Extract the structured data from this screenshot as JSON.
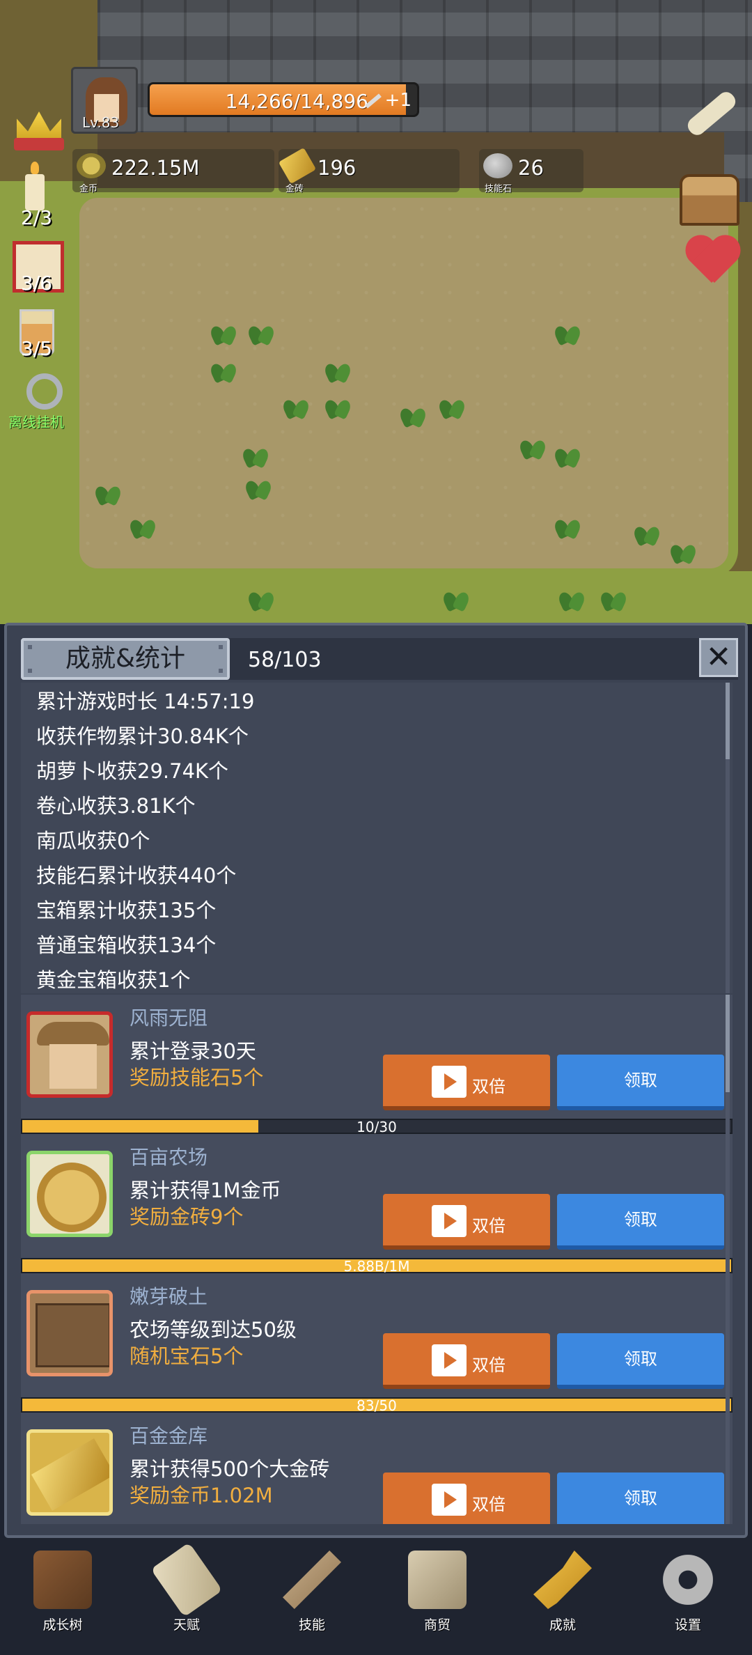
{
  "hud": {
    "level": "Lv.83",
    "hp_text": "14,266/14,896",
    "hp_fraction": 0.958,
    "hp_bonus": "+1",
    "resources": [
      {
        "caption": "金币",
        "value": "222.15M",
        "icon": "coin-icon"
      },
      {
        "caption": "金砖",
        "value": "196",
        "icon": "gold-brick-icon"
      },
      {
        "caption": "技能石",
        "value": "26",
        "icon": "skill-stone-icon"
      }
    ],
    "side": {
      "candle_count": "2/3",
      "dice_count": "3/6",
      "drink_count": "3/5",
      "offline_label": "离线挂机"
    }
  },
  "panel": {
    "title": "成就&统计",
    "count": "58/103",
    "close_icon": "close-icon",
    "stats": [
      "累计游戏时长 14:57:19",
      "收获作物累计30.84K个",
      "胡萝卜收获29.74K个",
      "卷心收获3.81K个",
      "南瓜收获0个",
      "技能石累计收获440个",
      "宝箱累计收获135个",
      "普通宝箱收获134个",
      "黄金宝箱收获1个"
    ],
    "achievements": [
      {
        "name": "风雨无阻",
        "desc": "累计登录30天",
        "reward": "奖励技能石5个",
        "double_label": "双倍",
        "claim_label": "领取",
        "progress_text": "10/30",
        "progress_fraction": 0.333
      },
      {
        "name": "百亩农场",
        "desc": "累计获得1M金币",
        "reward": "奖励金砖9个",
        "double_label": "双倍",
        "claim_label": "领取",
        "progress_text": "5.88B/1M",
        "progress_fraction": 1.0
      },
      {
        "name": "嫩芽破土",
        "desc": "农场等级到达50级",
        "reward": "随机宝石5个",
        "double_label": "双倍",
        "claim_label": "领取",
        "progress_text": "83/50",
        "progress_fraction": 1.0
      },
      {
        "name": "百金金库",
        "desc": "累计获得500个大金砖",
        "reward": "奖励金币1.02M",
        "double_label": "双倍",
        "claim_label": "领取"
      }
    ]
  },
  "nav": [
    {
      "label": "成长树",
      "icon": "book-icon"
    },
    {
      "label": "天赋",
      "icon": "scroll-icon"
    },
    {
      "label": "技能",
      "icon": "sword-icon"
    },
    {
      "label": "商贸",
      "icon": "map-icon"
    },
    {
      "label": "成就",
      "icon": "key-icon"
    },
    {
      "label": "设置",
      "icon": "gear-icon"
    }
  ],
  "colors": {
    "panel_bg": "#3b4252",
    "double_button": "#d9702f",
    "claim_button": "#3c88e0",
    "reward_text": "#f1ae3f",
    "progress_fill": "#f4b93a",
    "offline_text": "#8cff6a"
  }
}
